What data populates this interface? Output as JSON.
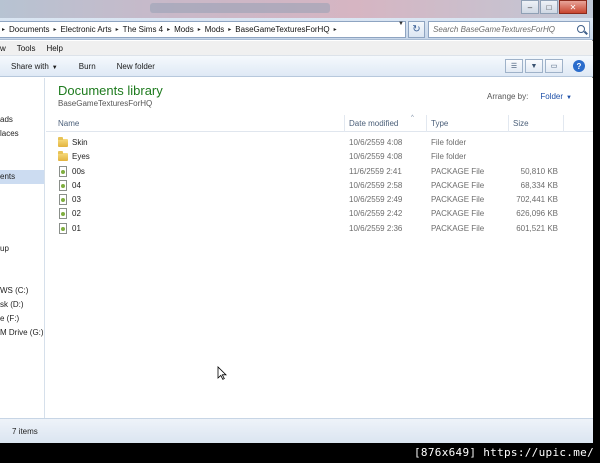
{
  "address": {
    "crumbs": [
      "Documents",
      "Electronic Arts",
      "The Sims 4",
      "Mods",
      "Mods",
      "BaseGameTexturesForHQ"
    ],
    "search_placeholder": "Search BaseGameTexturesForHQ"
  },
  "menu": {
    "items": [
      "w",
      "Tools",
      "Help"
    ]
  },
  "toolbar": {
    "share_with": "Share with",
    "burn": "Burn",
    "new_folder": "New folder"
  },
  "nav": {
    "items": [
      {
        "label": "ads",
        "selected": false
      },
      {
        "label": "laces",
        "selected": false
      },
      {
        "label": "ents",
        "selected": true
      },
      {
        "label": "up",
        "selected": false
      },
      {
        "label": "WS (C:)",
        "selected": false
      },
      {
        "label": "sk (D:)",
        "selected": false
      },
      {
        "label": "e (F:)",
        "selected": false
      },
      {
        "label": "M Drive (G:) N",
        "selected": false
      }
    ]
  },
  "library": {
    "title": "Documents library",
    "subtitle": "BaseGameTexturesForHQ",
    "arrange_label": "Arrange by:",
    "arrange_value": "Folder"
  },
  "columns": {
    "name": "Name",
    "date": "Date modified",
    "type": "Type",
    "size": "Size"
  },
  "files": [
    {
      "name": "Skin",
      "date": "10/6/2559 4:08",
      "type": "File folder",
      "size": "",
      "kind": "folder"
    },
    {
      "name": "Eyes",
      "date": "10/6/2559 4:08",
      "type": "File folder",
      "size": "",
      "kind": "folder"
    },
    {
      "name": "00s",
      "date": "11/6/2559 2:41",
      "type": "PACKAGE File",
      "size": "50,810 KB",
      "kind": "file"
    },
    {
      "name": "04",
      "date": "10/6/2559 2:58",
      "type": "PACKAGE File",
      "size": "68,334 KB",
      "kind": "file"
    },
    {
      "name": "03",
      "date": "10/6/2559 2:49",
      "type": "PACKAGE File",
      "size": "702,441 KB",
      "kind": "file"
    },
    {
      "name": "02",
      "date": "10/6/2559 2:42",
      "type": "PACKAGE File",
      "size": "626,096 KB",
      "kind": "file"
    },
    {
      "name": "01",
      "date": "10/6/2559 2:36",
      "type": "PACKAGE File",
      "size": "601,521 KB",
      "kind": "file"
    }
  ],
  "status": {
    "count": "7 items"
  },
  "watermark": "[876x649] https://upic.me/",
  "colors": {
    "library_title": "#1e7b1e",
    "link": "#1c4fa8",
    "selection": "#ccdcf1"
  }
}
